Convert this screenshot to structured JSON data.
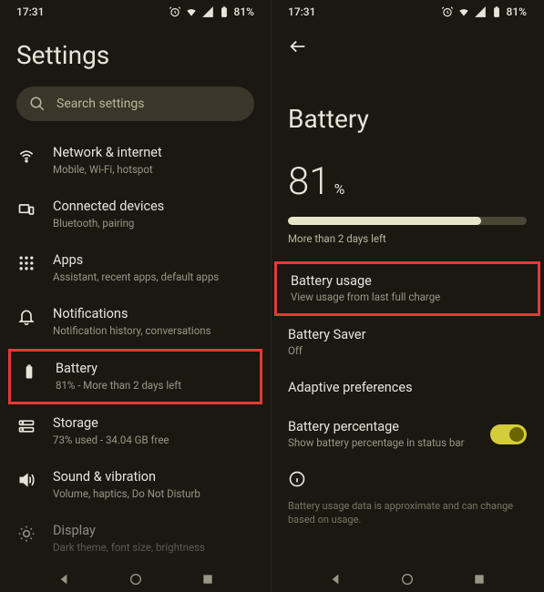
{
  "status": {
    "time": "17:31",
    "battery": "81%"
  },
  "left": {
    "title": "Settings",
    "search_placeholder": "Search settings",
    "items": [
      {
        "title": "Network & internet",
        "subtitle": "Mobile, Wi-Fi, hotspot"
      },
      {
        "title": "Connected devices",
        "subtitle": "Bluetooth, pairing"
      },
      {
        "title": "Apps",
        "subtitle": "Assistant, recent apps, default apps"
      },
      {
        "title": "Notifications",
        "subtitle": "Notification history, conversations"
      },
      {
        "title": "Battery",
        "subtitle": "81% - More than 2 days left"
      },
      {
        "title": "Storage",
        "subtitle": "73% used - 34.04 GB free"
      },
      {
        "title": "Sound & vibration",
        "subtitle": "Volume, haptics, Do Not Disturb"
      },
      {
        "title": "Display",
        "subtitle": "Dark theme, font size, brightness"
      }
    ]
  },
  "right": {
    "title": "Battery",
    "pct_value": "81",
    "pct_sign": "%",
    "time_left": "More than 2 days left",
    "items": [
      {
        "title": "Battery usage",
        "subtitle": "View usage from last full charge"
      },
      {
        "title": "Battery Saver",
        "subtitle": "Off"
      },
      {
        "title": "Adaptive preferences",
        "subtitle": ""
      },
      {
        "title": "Battery percentage",
        "subtitle": "Show battery percentage in status bar"
      }
    ],
    "disclaimer": "Battery usage data is approximate and can change based on usage."
  }
}
